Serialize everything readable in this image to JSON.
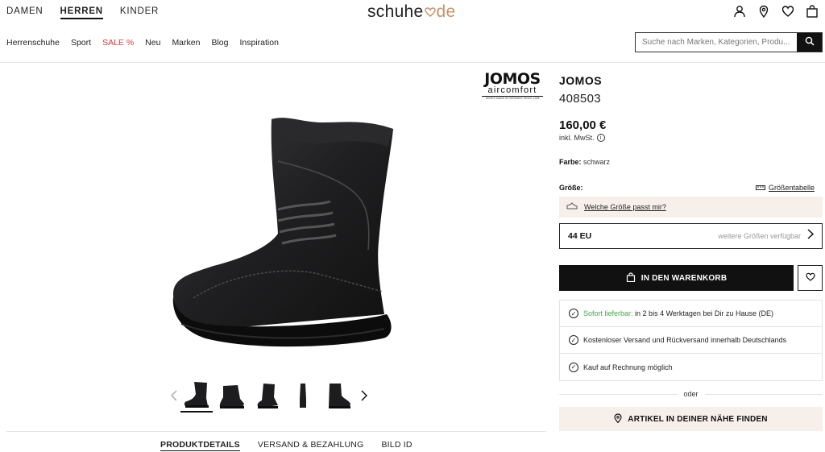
{
  "header": {
    "gender_tabs": [
      "DAMEN",
      "HERREN",
      "KINDER"
    ],
    "active_gender": "HERREN",
    "logo_left": "schuhe",
    "logo_right": "de",
    "icons": [
      "user-icon",
      "location-pin-icon",
      "heart-icon",
      "shopping-bag-icon"
    ]
  },
  "nav": {
    "items": [
      "Herrenschuhe",
      "Sport",
      "SALE %",
      "Neu",
      "Marken",
      "Blog",
      "Inspiration"
    ],
    "sale_color": "#e0323c"
  },
  "search": {
    "placeholder": "Suche nach Marken, Kategorien, Produ..."
  },
  "gallery": {
    "brand_logo_line1": "JOMOS",
    "brand_logo_line2": "aircomfort",
    "brand_logo_line3": "SHOES MADE IN GERMANY SINCE 1908",
    "thumbnail_count": 5,
    "active_thumbnail": 1
  },
  "tabs": [
    "PRODUKTDETAILS",
    "VERSAND & BEZAHLUNG",
    "BILD ID"
  ],
  "product": {
    "brand": "JOMOS",
    "article_number": "408503",
    "price": "160,00 €",
    "vat_note": "inkl. MwSt.",
    "color_label": "Farbe:",
    "color_value": "schwarz",
    "size_label": "Größe:",
    "size_table_link": "Größentabelle",
    "fit_question": "Welche Größe passt mir?",
    "selected_size": "44 EU",
    "more_sizes": "weitere Größen verfügbar",
    "cart_button": "IN DEN WARENKORB",
    "delivery_highlight": "Sofort lieferbar:",
    "delivery_text": "in 2 bis 4 Werktagen bei Dir zu Hause (DE)",
    "shipping_text": "Kostenloser Versand und Rückversand innerhalb Deutschlands",
    "invoice_text": "Kauf auf Rechnung möglich",
    "or_text": "oder",
    "store_button": "ARTIKEL IN DEINER NÄHE FINDEN"
  },
  "colors": {
    "accent_green": "#47a447",
    "beige_panel": "#f6efea",
    "logo_accent": "#c9926a"
  }
}
